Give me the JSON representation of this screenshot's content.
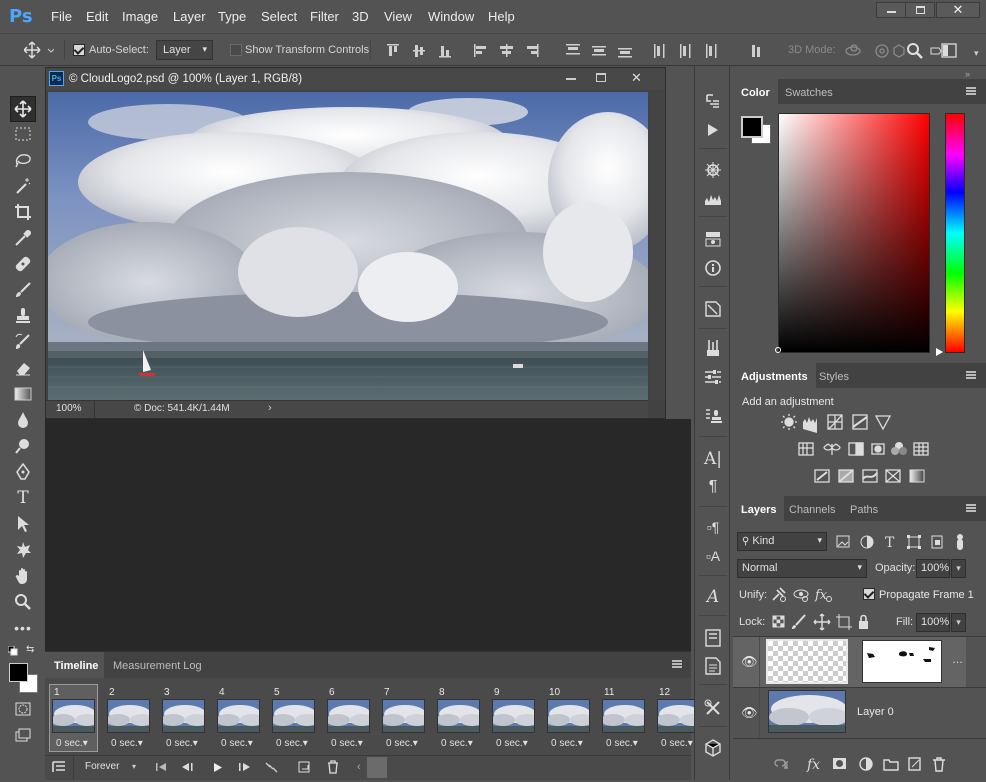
{
  "app": {
    "logo": "Ps"
  },
  "menu": [
    "File",
    "Edit",
    "Image",
    "Layer",
    "Type",
    "Select",
    "Filter",
    "3D",
    "View",
    "Window",
    "Help"
  ],
  "options": {
    "auto_select_label": "Auto-Select:",
    "auto_select_checked": true,
    "auto_select_value": "Layer",
    "show_transform_label": "Show Transform Controls",
    "mode_3d_label": "3D Mode:"
  },
  "document": {
    "title": "© CloudLogo2.psd @ 100% (Layer 1, RGB/8)",
    "zoom": "100%",
    "doc_size": "© Doc: 541.4K/1.44M"
  },
  "timeline": {
    "tabs": [
      "Timeline",
      "Measurement Log"
    ],
    "frames": [
      {
        "num": "1",
        "dur": "0 sec."
      },
      {
        "num": "2",
        "dur": "0 sec."
      },
      {
        "num": "3",
        "dur": "0 sec."
      },
      {
        "num": "4",
        "dur": "0 sec."
      },
      {
        "num": "5",
        "dur": "0 sec."
      },
      {
        "num": "6",
        "dur": "0 sec."
      },
      {
        "num": "7",
        "dur": "0 sec."
      },
      {
        "num": "8",
        "dur": "0 sec."
      },
      {
        "num": "9",
        "dur": "0 sec."
      },
      {
        "num": "10",
        "dur": "0 sec."
      },
      {
        "num": "11",
        "dur": "0 sec."
      },
      {
        "num": "12",
        "dur": "0 sec."
      }
    ],
    "loop": "Forever"
  },
  "color_panel": {
    "tabs": [
      "Color",
      "Swatches"
    ],
    "foreground": "#000000",
    "background": "#ffffff",
    "hue": "#ff0000"
  },
  "adjustments_panel": {
    "tabs": [
      "Adjustments",
      "Styles"
    ],
    "heading": "Add an adjustment"
  },
  "layers_panel": {
    "tabs": [
      "Layers",
      "Channels",
      "Paths"
    ],
    "filter_label": "Kind",
    "blend_mode": "Normal",
    "opacity_label": "Opacity:",
    "opacity": "100%",
    "unify_label": "Unify:",
    "propagate_label": "Propagate Frame 1",
    "propagate_checked": true,
    "lock_label": "Lock:",
    "fill_label": "Fill:",
    "fill": "100%",
    "layers": [
      {
        "name": "",
        "visible": true,
        "has_mask": true
      },
      {
        "name": "Layer 0",
        "visible": true,
        "has_mask": false
      }
    ]
  },
  "colors": {
    "accent": "#4aa6ff",
    "ui_bg": "#535353",
    "work_bg": "#282828"
  }
}
